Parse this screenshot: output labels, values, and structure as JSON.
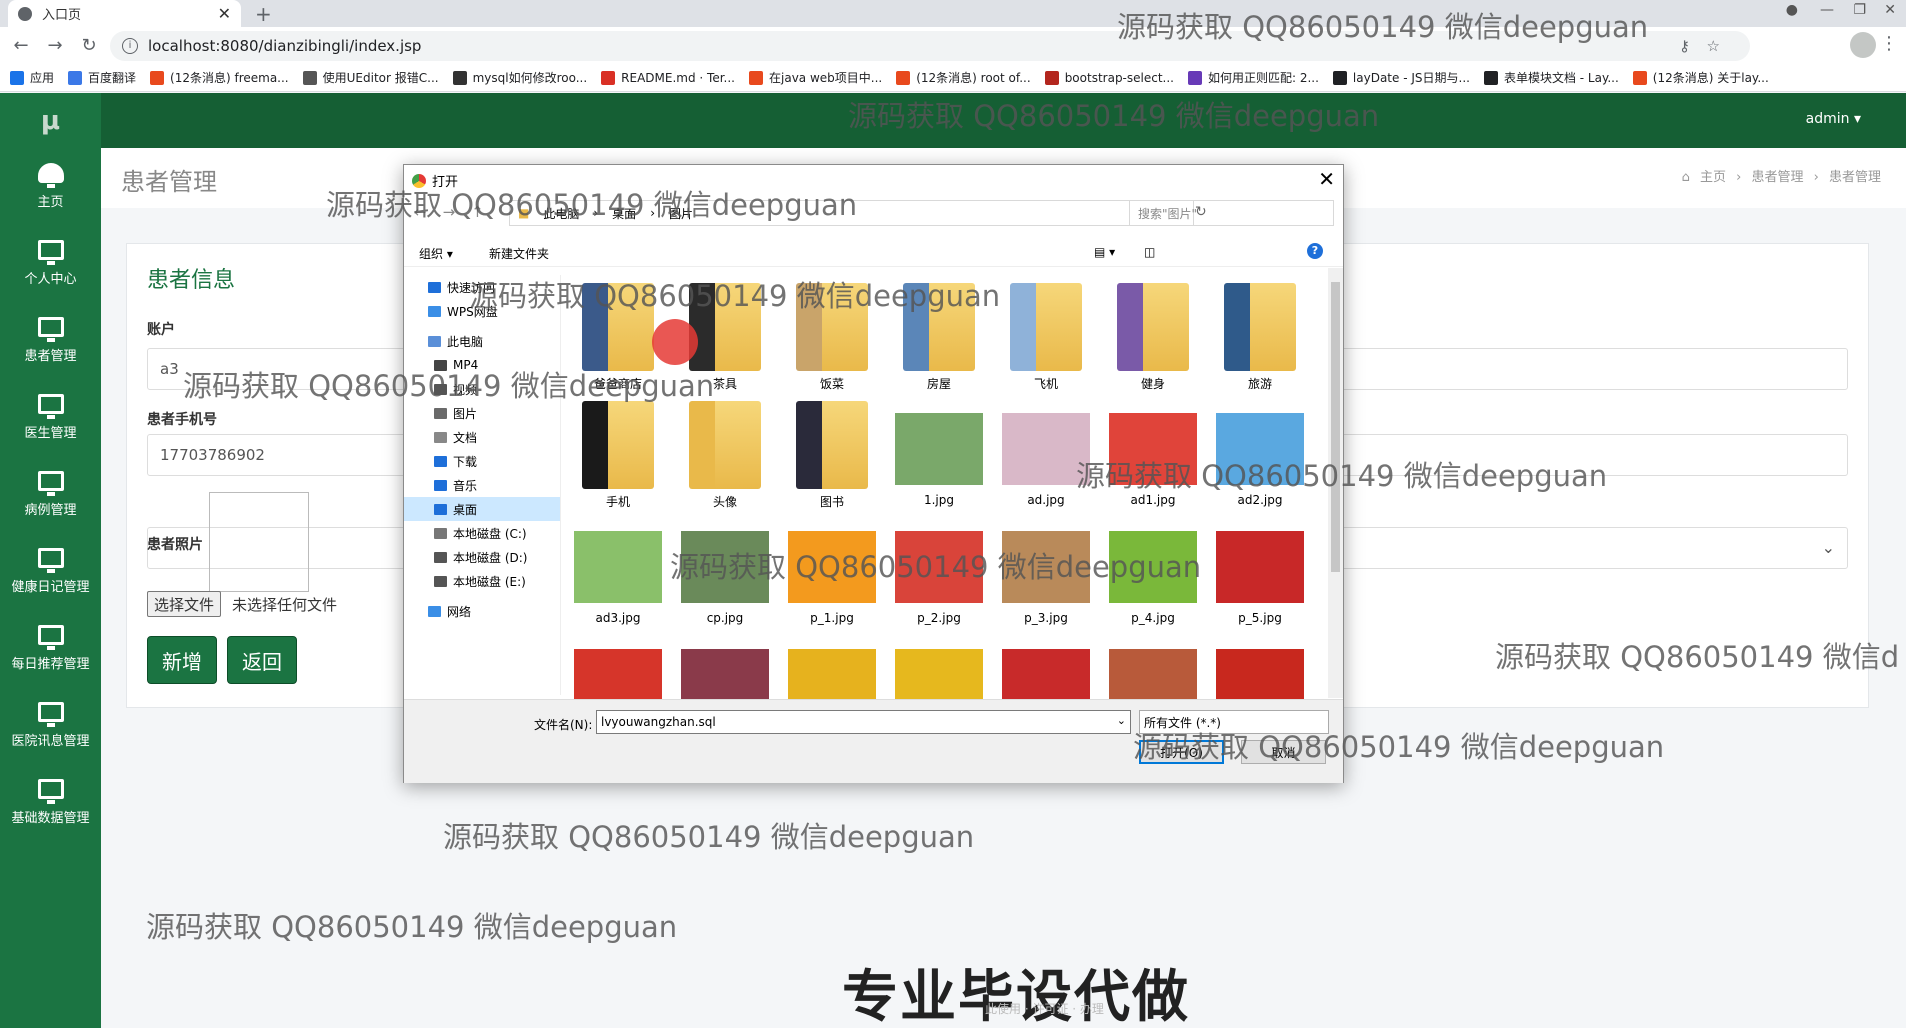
{
  "browser": {
    "tab_title": "入口页",
    "url": "localhost:8080/dianzibingli/index.jsp",
    "bookmarks": [
      "应用",
      "百度翻译",
      "(12条消息) freema...",
      "使用UEditor 报错C...",
      "mysql如何修改roo...",
      "README.md · Ter...",
      "在java web项目中...",
      "(12条消息) root of...",
      "bootstrap-select...",
      "如何用正则匹配: 2...",
      "layDate - JS日期与...",
      "表单模块文档 - Lay...",
      "(12条消息) 关于lay..."
    ],
    "bookmark_colors": [
      "#1a73e8",
      "#3b78e7",
      "#e8491d",
      "#555555",
      "#333333",
      "#d93025",
      "#e8491d",
      "#e8491d",
      "#b3261e",
      "#673ab7",
      "#202124",
      "#202124",
      "#e8491d"
    ]
  },
  "app": {
    "logo": "μ",
    "user": "admin ▾",
    "sidebar": [
      {
        "label": "主页",
        "icon": "dashboard-icon"
      },
      {
        "label": "个人中心",
        "icon": "monitor-icon"
      },
      {
        "label": "患者管理",
        "icon": "monitor-icon"
      },
      {
        "label": "医生管理",
        "icon": "monitor-icon"
      },
      {
        "label": "病例管理",
        "icon": "monitor-icon"
      },
      {
        "label": "健康日记管理",
        "icon": "monitor-icon"
      },
      {
        "label": "每日推荐管理",
        "icon": "monitor-icon"
      },
      {
        "label": "医院讯息管理",
        "icon": "monitor-icon"
      },
      {
        "label": "基础数据管理",
        "icon": "monitor-icon"
      }
    ],
    "page_title": "患者管理",
    "breadcrumb": [
      "主页",
      "患者管理",
      "患者管理"
    ],
    "form": {
      "card_title": "患者信息",
      "account_label": "账户",
      "account_value": "a3",
      "phone_label": "患者手机号",
      "phone_value": "17703786902",
      "photo_label": "患者照片",
      "file_button": "选择文件",
      "file_none": "未选择任何文件",
      "add_button": "新增",
      "back_button": "返回"
    }
  },
  "dialog": {
    "title": "打开",
    "path": [
      "此电脑",
      "桌面",
      "图片"
    ],
    "search_placeholder": "搜索\"图片\"",
    "organize": "组织 ▾",
    "new_folder": "新建文件夹",
    "tree": [
      {
        "label": "快速访问",
        "color": "#1e6fd9"
      },
      {
        "label": "WPS网盘",
        "color": "#3a8ee6"
      },
      {
        "label": "此电脑",
        "color": "#5a8fd8"
      },
      {
        "label": "MP4",
        "color": "#444444"
      },
      {
        "label": "视频",
        "color": "#555555"
      },
      {
        "label": "图片",
        "color": "#6a6a6a"
      },
      {
        "label": "文档",
        "color": "#888888"
      },
      {
        "label": "下载",
        "color": "#1e6fd9"
      },
      {
        "label": "音乐",
        "color": "#1e6fd9"
      },
      {
        "label": "桌面",
        "color": "#1e6fd9"
      },
      {
        "label": "本地磁盘 (C:)",
        "color": "#777777"
      },
      {
        "label": "本地磁盘 (D:)",
        "color": "#555555"
      },
      {
        "label": "本地磁盘 (E:)",
        "color": "#555555"
      },
      {
        "label": "网络",
        "color": "#3a8ee6"
      }
    ],
    "files": [
      {
        "name": "爸爸商店",
        "kind": "folder",
        "color": "#3b5a8a"
      },
      {
        "name": "茶具",
        "kind": "folder",
        "color": "#2b2b2b"
      },
      {
        "name": "饭菜",
        "kind": "folder",
        "color": "#c9a46a"
      },
      {
        "name": "房屋",
        "kind": "folder",
        "color": "#5b86b8"
      },
      {
        "name": "飞机",
        "kind": "folder",
        "color": "#8fb2d9"
      },
      {
        "name": "健身",
        "kind": "folder",
        "color": "#7a5aa8"
      },
      {
        "name": "旅游",
        "kind": "folder",
        "color": "#2f5a8a"
      },
      {
        "name": "手机",
        "kind": "folder",
        "color": "#1a1a1a"
      },
      {
        "name": "头像",
        "kind": "folder",
        "color": "#e9b94a"
      },
      {
        "name": "图书",
        "kind": "folder",
        "color": "#2a2a3a"
      },
      {
        "name": "1.jpg",
        "kind": "image",
        "color": "#7aa86a"
      },
      {
        "name": "ad.jpg",
        "kind": "image",
        "color": "#d9b8c8"
      },
      {
        "name": "ad1.jpg",
        "kind": "image",
        "color": "#e0443a"
      },
      {
        "name": "ad2.jpg",
        "kind": "image",
        "color": "#5aa8e0"
      },
      {
        "name": "ad3.jpg",
        "kind": "image",
        "color": "#8ac06a"
      },
      {
        "name": "cp.jpg",
        "kind": "image",
        "color": "#6a8a5a"
      },
      {
        "name": "p_1.jpg",
        "kind": "image",
        "color": "#f39a1e"
      },
      {
        "name": "p_2.jpg",
        "kind": "image",
        "color": "#d9443a"
      },
      {
        "name": "p_3.jpg",
        "kind": "image",
        "color": "#b98a5a"
      },
      {
        "name": "p_4.jpg",
        "kind": "image",
        "color": "#7ab83a"
      },
      {
        "name": "p_5.jpg",
        "kind": "image",
        "color": "#c82828"
      },
      {
        "name": "",
        "kind": "image",
        "color": "#d6352a"
      },
      {
        "name": "",
        "kind": "image",
        "color": "#8a3a4a"
      },
      {
        "name": "",
        "kind": "image",
        "color": "#e6b21e"
      },
      {
        "name": "",
        "kind": "image",
        "color": "#e6b81e"
      },
      {
        "name": "",
        "kind": "image",
        "color": "#c82a2a"
      },
      {
        "name": "",
        "kind": "image",
        "color": "#b85a3a"
      },
      {
        "name": "",
        "kind": "image",
        "color": "#c8281e"
      }
    ],
    "filename_label": "文件名(N):",
    "filename_value": "lvyouwangzhan.sql",
    "filetype": "所有文件 (*.*)",
    "open_button": "打开(O)",
    "cancel_button": "取消"
  },
  "overlays": {
    "watermark": "源码获取 QQ86050149 微信deepguan",
    "watermark_clipped": "源码获取 QQ86050149 微信d",
    "watermark_folder": "源码获取 QQ86050149 微信deepguan",
    "banner": "专业毕设代做",
    "footer": "此使用 · 许可证 · 办理"
  }
}
